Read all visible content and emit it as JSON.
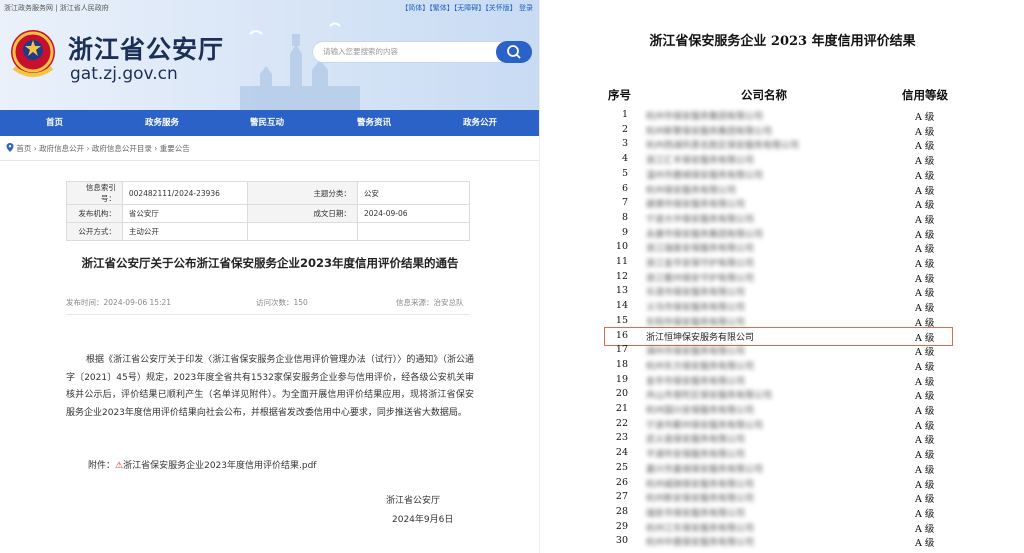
{
  "left_page": {
    "topbar": {
      "left": "浙江政务服务网 | 浙江省人民政府",
      "right": "【简体】【繁体】【无障碍】【关怀版】 登录"
    },
    "site": {
      "name": "浙江省公安厅",
      "domain": "gat.zj.gov.cn"
    },
    "search": {
      "placeholder": "请输入您要搜索的内容"
    },
    "nav": [
      "首页",
      "政务服务",
      "警民互动",
      "警务资讯",
      "政务公开"
    ],
    "breadcrumb": "首页 › 政府信息公开 › 政府信息公开目录 › 重要公告",
    "meta": {
      "index_label": "信息索引号：",
      "index_value": "002482111/2024-23936",
      "category_label": "主题分类：",
      "category_value": "公安",
      "publisher_label": "发布机构：",
      "publisher_value": "省公安厅",
      "date_label": "成文日期：",
      "date_value": "2024-09-06",
      "method_label": "公开方式：",
      "method_value": "主动公开"
    },
    "article_title": "浙江省公安厅关于公布浙江省保安服务企业2023年度信用评价结果的通告",
    "info": {
      "published": "发布时间：2024-09-06 15:21",
      "views": "访问次数：150",
      "source": "信息来源：治安总队"
    },
    "body": "根据《浙江省公安厅关于印发〈浙江省保安服务企业信用评价管理办法（试行）〉的通知》（浙公通字〔2021〕45号）规定，2023年度全省共有1532家保安服务企业参与信用评价，经各级公安机关审核并公示后，评价结果已顺利产生（名单详见附件）。为全面开展信用评价结果应用，现将浙江省保安服务企业2023年度信用评价结果向社会公布，并根据省发改委信用中心要求，同步推送省大数据局。",
    "attachment_label": "附件：",
    "attachment_file": "浙江省保安服务企业2023年度信用评价结果.pdf",
    "sign_org": "浙江省公安厅",
    "sign_date": "2024年9月6日"
  },
  "right_page": {
    "title": "浙江省保安服务企业 2023 年度信用评价结果",
    "headers": {
      "no": "序号",
      "name": "公司名称",
      "grade": "信用等级"
    },
    "rows": [
      {
        "no": "1",
        "name": "杭州市保安服务集团有限公司",
        "grade": "A 级",
        "blur": true
      },
      {
        "no": "2",
        "name": "杭州新警保安服务集团有限公司",
        "grade": "A 级",
        "blur": true
      },
      {
        "no": "3",
        "name": "杭州西湖风景名胜区保安服务有限公司",
        "grade": "A 级",
        "blur": true
      },
      {
        "no": "4",
        "name": "浙江汇丰保安服务有限公司",
        "grade": "A 级",
        "blur": true
      },
      {
        "no": "5",
        "name": "温州市鹿城保安服务有限公司",
        "grade": "A 级",
        "blur": true
      },
      {
        "no": "6",
        "name": "杭州保安服务有限公司",
        "grade": "A 级",
        "blur": true
      },
      {
        "no": "7",
        "name": "建德市保安服务有限公司",
        "grade": "A 级",
        "blur": true
      },
      {
        "no": "8",
        "name": "宁波大中保安服务有限公司",
        "grade": "A 级",
        "blur": true
      },
      {
        "no": "9",
        "name": "永康市保安服务集团有限公司",
        "grade": "A 级",
        "blur": true
      },
      {
        "no": "10",
        "name": "浙江瑞泰安保服务有限公司",
        "grade": "A 级",
        "blur": true
      },
      {
        "no": "11",
        "name": "浙江金华安保守护有限公司",
        "grade": "A 级",
        "blur": true
      },
      {
        "no": "12",
        "name": "浙江衢州保安守护有限公司",
        "grade": "A 级",
        "blur": true
      },
      {
        "no": "13",
        "name": "乐清市保安服务有限公司",
        "grade": "A 级",
        "blur": true
      },
      {
        "no": "14",
        "name": "义乌市保安服务有限公司",
        "grade": "A 级",
        "blur": true
      },
      {
        "no": "15",
        "name": "东阳市保安服务有限公司",
        "grade": "A 级",
        "blur": true
      },
      {
        "no": "16",
        "name": "浙江恒坤保安服务有限公司",
        "grade": "A 级",
        "blur": false,
        "highlight": true
      },
      {
        "no": "17",
        "name": "湖州市保安服务有限公司",
        "grade": "A 级",
        "blur": true
      },
      {
        "no": "18",
        "name": "杭州东方保安服务有限公司",
        "grade": "A 级",
        "blur": true
      },
      {
        "no": "19",
        "name": "金华市保安服务有限公司",
        "grade": "A 级",
        "blur": true
      },
      {
        "no": "20",
        "name": "舟山市普陀区保安服务有限公司",
        "grade": "A 级",
        "blur": true
      },
      {
        "no": "21",
        "name": "杭州国兴安保服务有限公司",
        "grade": "A 级",
        "blur": true
      },
      {
        "no": "22",
        "name": "宁波市鄞州保安服务有限公司",
        "grade": "A 级",
        "blur": true
      },
      {
        "no": "23",
        "name": "武义县保安服务有限公司",
        "grade": "A 级",
        "blur": true
      },
      {
        "no": "24",
        "name": "平湖市安保服务有限公司",
        "grade": "A 级",
        "blur": true
      },
      {
        "no": "25",
        "name": "嘉兴市嘉城保安服务有限公司",
        "grade": "A 级",
        "blur": true
      },
      {
        "no": "26",
        "name": "杭州威驰保安服务有限公司",
        "grade": "A 级",
        "blur": true
      },
      {
        "no": "27",
        "name": "杭州新安保安服务有限公司",
        "grade": "A 级",
        "blur": true
      },
      {
        "no": "28",
        "name": "瑞安市保安服务有限公司",
        "grade": "A 级",
        "blur": true
      },
      {
        "no": "29",
        "name": "杭州江东保安服务有限公司",
        "grade": "A 级",
        "blur": true
      },
      {
        "no": "30",
        "name": "杭州中盾保安服务有限公司",
        "grade": "A 级",
        "blur": true
      }
    ],
    "colors": {
      "highlight_border": "#e06b4a"
    }
  },
  "colors": {
    "nav_bg": "#2a62c7",
    "brand_dark": "#1b2f57"
  }
}
